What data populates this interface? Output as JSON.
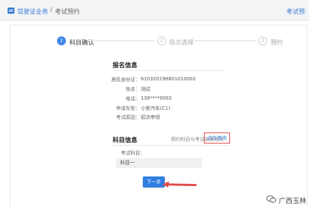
{
  "header": {
    "breadcrumb_home": "驾驶证业务",
    "breadcrumb_sep": "/",
    "breadcrumb_current": "考试预约",
    "right_link": "考试预"
  },
  "steps": [
    {
      "number": "1",
      "label": "科目确认",
      "state": "active"
    },
    {
      "number": "2",
      "label": "场次选择",
      "state": "inactive"
    },
    {
      "number": "3",
      "label": "预约",
      "state": "inactive"
    }
  ],
  "signup": {
    "title": "报名信息",
    "fields": [
      {
        "label": "居民身份证：",
        "value": "610320198801010002"
      },
      {
        "label": "姓名：",
        "value": "测试"
      },
      {
        "label": "电话：",
        "value": "138****0002"
      },
      {
        "label": "申请车型：",
        "value": "小型汽车(C1)"
      },
      {
        "label": "考试原因：",
        "value": "初次申领"
      }
    ]
  },
  "subject": {
    "title": "科目信息",
    "hint": "预约科目与考试结果有关",
    "query_link": "点击查询",
    "field_label": "考试科目：",
    "field_value": "科目一"
  },
  "next_button": "下一步",
  "watermark": {
    "text": "广西玉林"
  },
  "colors": {
    "accent": "#3f87e6",
    "link": "#3a7bd5",
    "highlight": "#e04848"
  }
}
